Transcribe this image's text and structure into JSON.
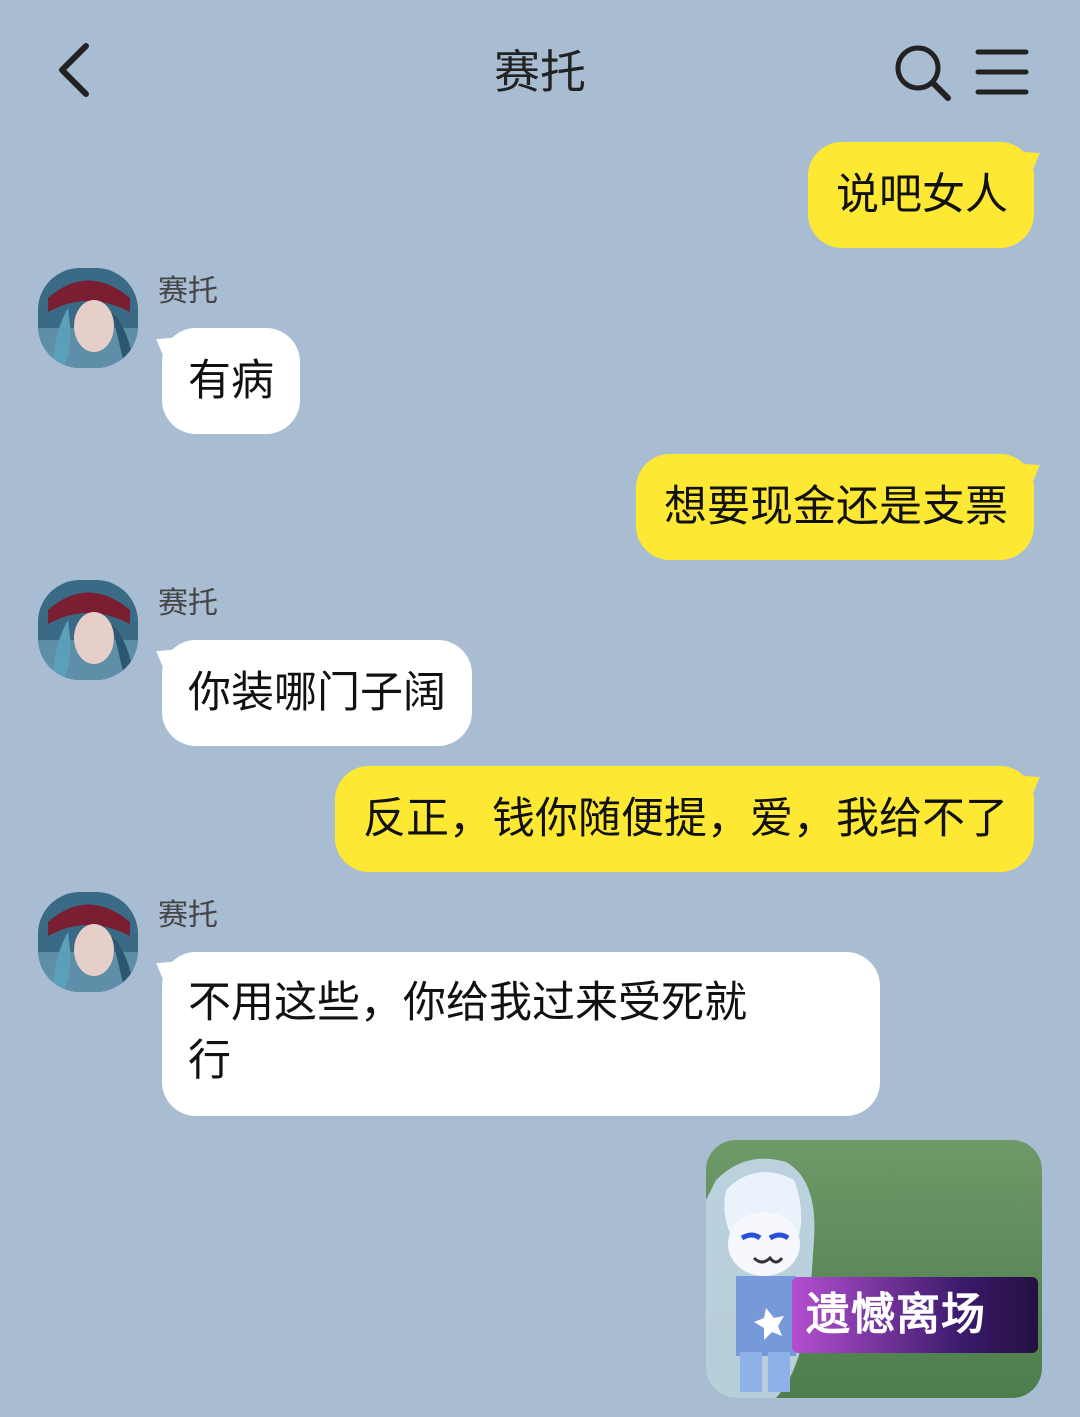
{
  "header": {
    "title": "赛托",
    "back_icon": "chevron-left-icon",
    "search_icon": "search-icon",
    "menu_icon": "hamburger-menu-icon"
  },
  "messages": [
    {
      "direction": "out",
      "text": "说吧女人"
    },
    {
      "direction": "in",
      "sender": "赛托",
      "text": "有病"
    },
    {
      "direction": "out",
      "text": "想要现金还是支票"
    },
    {
      "direction": "in",
      "sender": "赛托",
      "text": "你装哪门子阔"
    },
    {
      "direction": "out",
      "text": "反正，钱你随便提，爱，我给不了"
    },
    {
      "direction": "in",
      "sender": "赛托",
      "line1": "不用这些，你给我过来受死就",
      "line2": "行"
    },
    {
      "direction": "out",
      "type": "sticker",
      "caption": "遗憾离场"
    }
  ],
  "colors": {
    "background": "#a9bdd2",
    "outgoing_bubble": "#fde934",
    "incoming_bubble": "#ffffff"
  }
}
